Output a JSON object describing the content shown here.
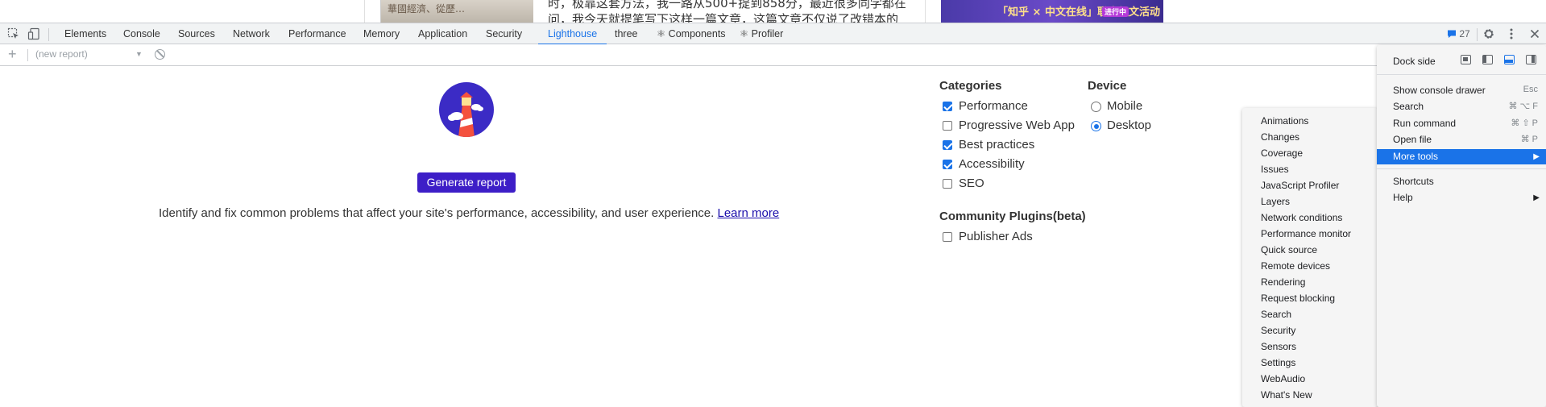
{
  "page_strip": {
    "img1_text": "華國經濟、從歷…",
    "text_line1": "时，极靠这套方法，我一路从500+提到858分，最近很多同学都在",
    "text_line2": "问，我今天就提笔写下这样一篇文章，这篇文章不仅说了改错本的",
    "banner_text": "「知乎 × 中文在线」联合征文活动",
    "banner_badge": "进行中"
  },
  "tabs": [
    {
      "label": "Elements"
    },
    {
      "label": "Console"
    },
    {
      "label": "Sources"
    },
    {
      "label": "Network"
    },
    {
      "label": "Performance"
    },
    {
      "label": "Memory"
    },
    {
      "label": "Application"
    },
    {
      "label": "Security"
    },
    {
      "label": "Lighthouse",
      "active": true
    },
    {
      "label": "three"
    },
    {
      "label": "⚛ Components"
    },
    {
      "label": "⚛ Profiler"
    }
  ],
  "toolbar_right": {
    "issues_count": "27"
  },
  "lh_toolbar": {
    "report_select": "(new report)"
  },
  "lighthouse": {
    "generate_button": "Generate report",
    "description": "Identify and fix common problems that affect your site's performance, accessibility, and user experience.",
    "learn_more": "Learn more",
    "categories_title": "Categories",
    "categories": [
      {
        "label": "Performance",
        "checked": true
      },
      {
        "label": "Progressive Web App",
        "checked": false
      },
      {
        "label": "Best practices",
        "checked": true
      },
      {
        "label": "Accessibility",
        "checked": true
      },
      {
        "label": "SEO",
        "checked": false
      }
    ],
    "device_title": "Device",
    "devices": [
      {
        "label": "Mobile",
        "selected": false
      },
      {
        "label": "Desktop",
        "selected": true
      }
    ],
    "plugins_title": "Community Plugins(beta)",
    "plugins": [
      {
        "label": "Publisher Ads",
        "checked": false
      }
    ]
  },
  "main_menu": {
    "dock_side": "Dock side",
    "show_console_drawer": "Show console drawer",
    "show_console_drawer_shortcut": "Esc",
    "search": "Search",
    "search_shortcut": "⌘ ⌥ F",
    "run_command": "Run command",
    "run_command_shortcut": "⌘ ⇧ P",
    "open_file": "Open file",
    "open_file_shortcut": "⌘ P",
    "more_tools": "More tools",
    "shortcuts": "Shortcuts",
    "help": "Help"
  },
  "more_tools_menu": [
    "Animations",
    "Changes",
    "Coverage",
    "Issues",
    "JavaScript Profiler",
    "Layers",
    "Network conditions",
    "Performance monitor",
    "Quick source",
    "Remote devices",
    "Rendering",
    "Request blocking",
    "Search",
    "Security",
    "Sensors",
    "Settings",
    "WebAudio",
    "What's New"
  ],
  "colors": {
    "accent": "#1a73e8",
    "generate_button": "#3d1ec7",
    "logo_bg": "#3b2bc5"
  }
}
